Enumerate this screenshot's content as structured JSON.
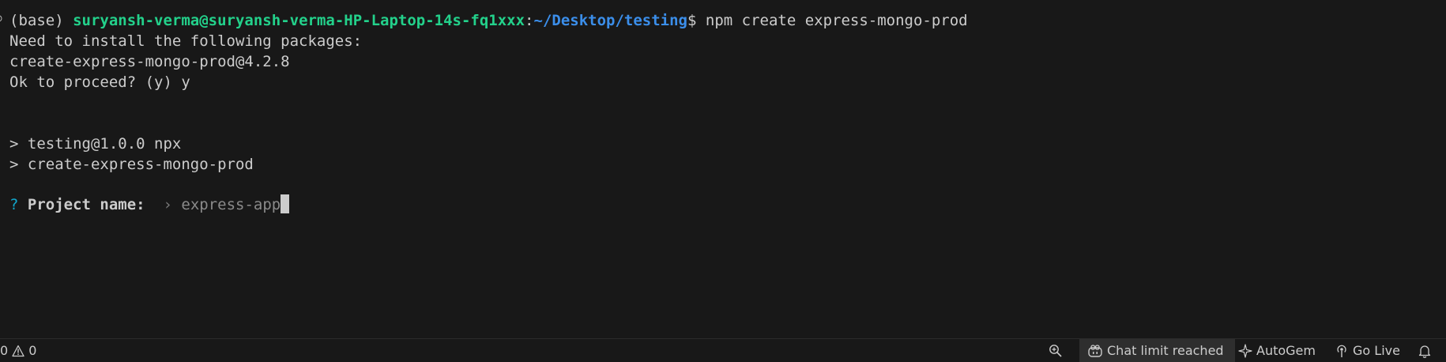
{
  "terminal": {
    "prompt": {
      "env": "(base)",
      "user_host": "suryansh-verma@suryansh-verma-HP-Laptop-14s-fq1xxx",
      "sep": ":",
      "path": "~/Desktop/testing",
      "symbol": "$",
      "command": "npm create express-mongo-prod"
    },
    "lines": [
      "Need to install the following packages:",
      "create-express-mongo-prod@4.2.8",
      "Ok to proceed? (y) y",
      "> testing@1.0.0 npx",
      "> create-express-mongo-prod"
    ],
    "question": {
      "mark": "?",
      "label": "Project name:",
      "chevron": "›",
      "value": "express-app"
    },
    "edge_glyph": "○"
  },
  "statusbar": {
    "errors": "0",
    "warnings": "0",
    "chat": "Chat limit reached",
    "autogem": "AutoGem",
    "golive": "Go Live"
  },
  "colors": {
    "background": "#181818",
    "user_host": "#23d18b",
    "path": "#3b8eea",
    "question_mark": "#11a8cd",
    "text": "#cccccc"
  }
}
